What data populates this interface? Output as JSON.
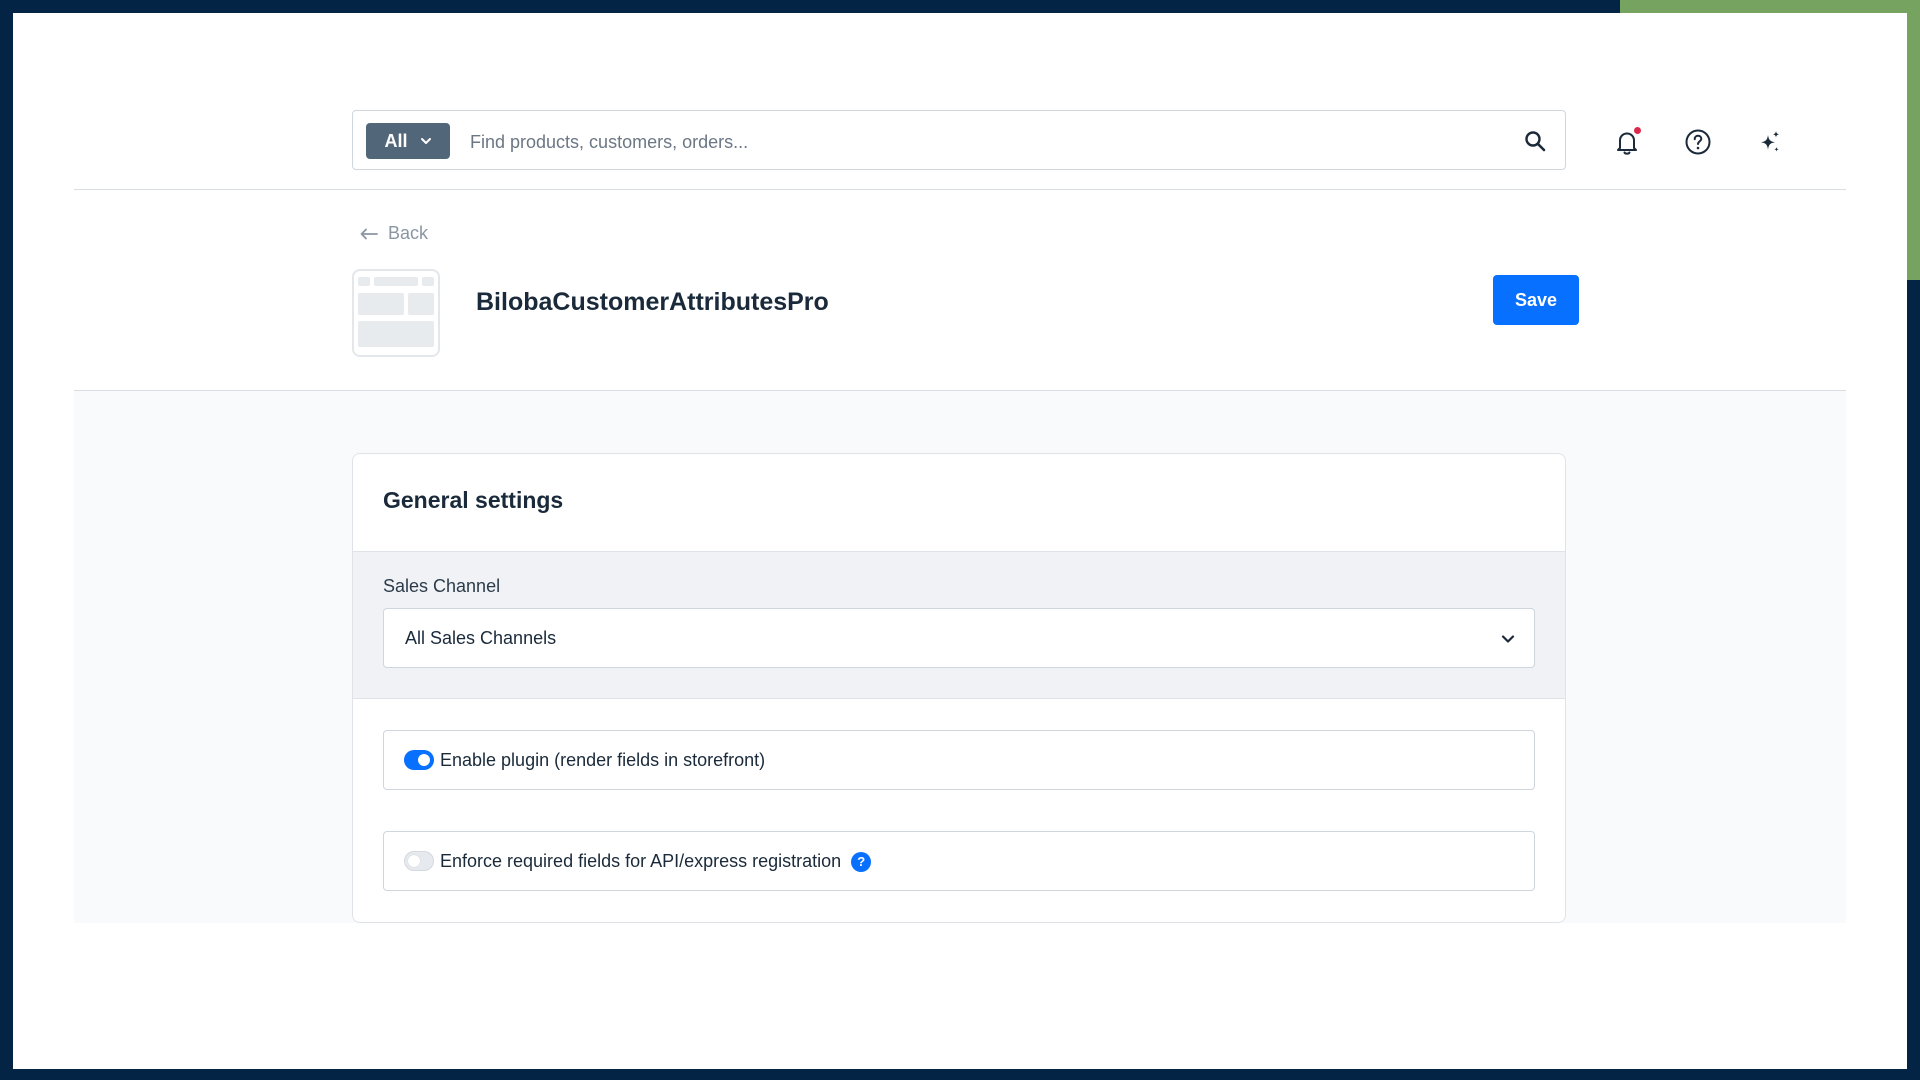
{
  "search": {
    "filter_label": "All",
    "placeholder": "Find products, customers, orders..."
  },
  "header": {
    "back_label": "Back",
    "title": "BilobaCustomerAttributesPro",
    "save_label": "Save"
  },
  "settings": {
    "card_title": "General settings",
    "sales_channel_label": "Sales Channel",
    "sales_channel_value": "All Sales Channels",
    "toggles": [
      {
        "label": "Enable plugin (render fields in storefront)",
        "enabled": true
      },
      {
        "label": "Enforce required fields for API/express registration",
        "enabled": false,
        "help": "?"
      }
    ]
  },
  "colors": {
    "primary": "#0870ff",
    "filter_button": "#52667a",
    "notification_dot": "#de294c",
    "frame_background": "#042446",
    "frame_accent": "#76a460"
  },
  "icons": [
    "chevron-down-icon",
    "search-icon",
    "bell-icon",
    "help-circle-icon",
    "sparkles-icon",
    "arrow-left-icon"
  ]
}
